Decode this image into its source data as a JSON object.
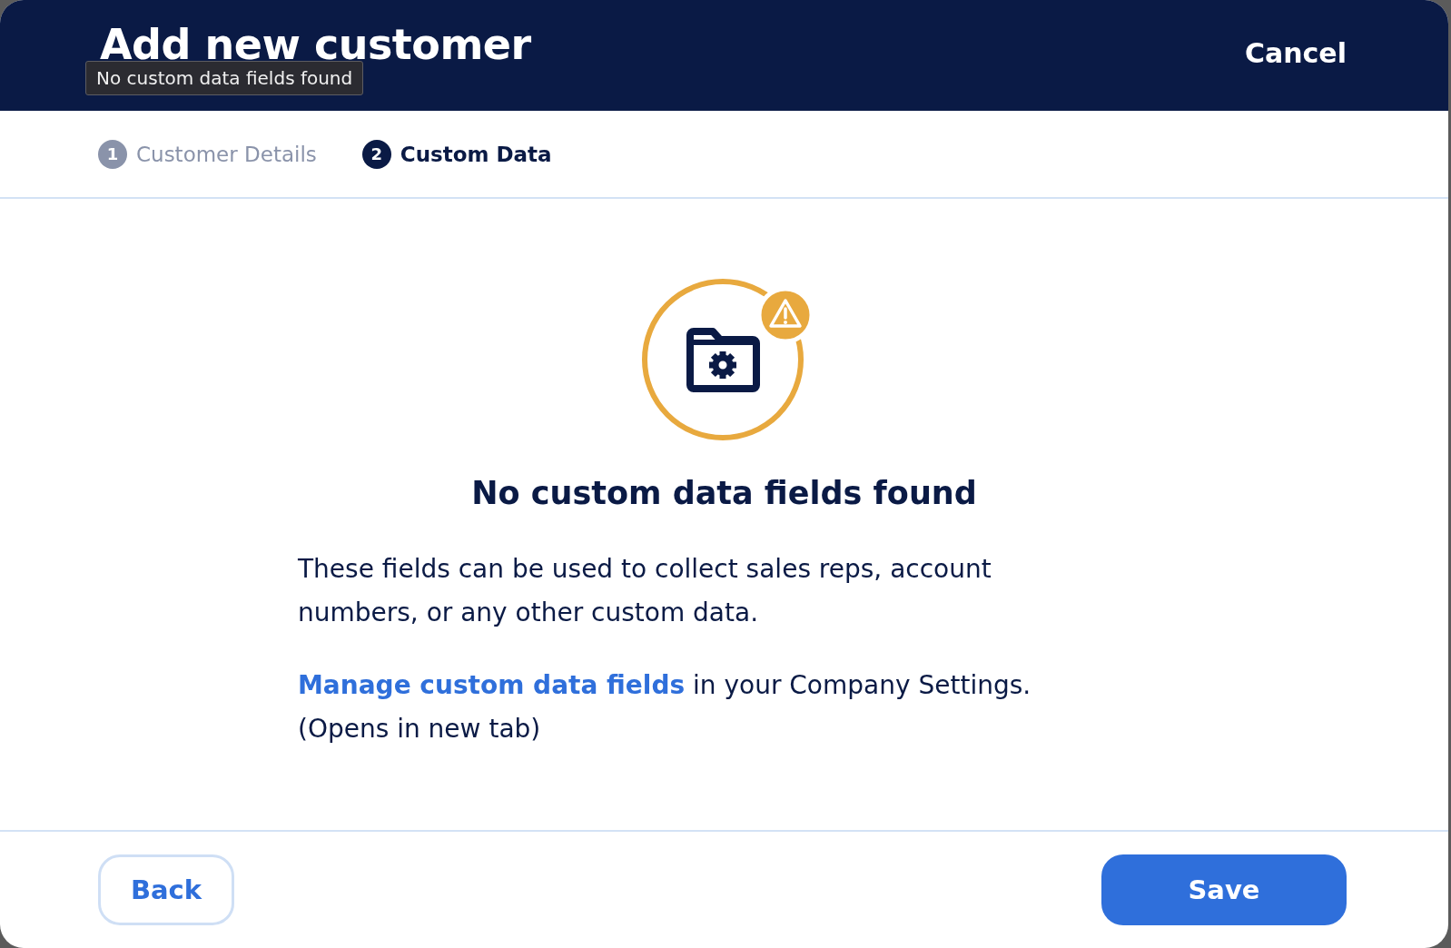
{
  "dialog": {
    "title": "Add new customer",
    "cancel": "Cancel"
  },
  "tooltip": "No custom data fields found",
  "steps": [
    {
      "number": "1",
      "label": "Customer Details",
      "selected": false
    },
    {
      "number": "2",
      "label": "Custom Data",
      "selected": true
    }
  ],
  "empty_state": {
    "heading": "No custom data fields found",
    "description": "These fields can be used to collect sales reps, account numbers, or any other custom data.",
    "link": "Manage custom data fields",
    "after_link": "in your Company Settings. (Opens in new tab)"
  },
  "footer": {
    "back": "Back",
    "save": "Save"
  }
}
